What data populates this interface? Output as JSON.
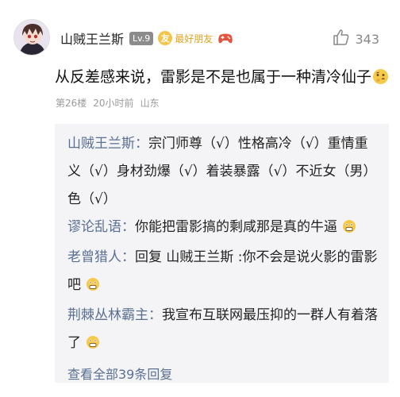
{
  "comment": {
    "author": "山贼王兰斯",
    "level": "Lv.9",
    "friend_badge_glyph": "友",
    "friend_badge": "最好朋友",
    "likes": "343",
    "text": "从反差感来说，雷影是不是也属于一种清冷仙子",
    "floor": "第26楼",
    "time": "20小时前",
    "location": "山东"
  },
  "replies": [
    {
      "author": "山贼王兰斯",
      "separator": "：",
      "text": "宗门师尊（√）性格高冷（√）重情重义（√）身材劲爆（√）着装暴露（√）不近女（男）色（√）"
    },
    {
      "author": "谬论乱语",
      "separator": "：",
      "text": "你能把雷影搞的剩咸那是真的牛逼"
    },
    {
      "author": "老曾猎人",
      "separator": "：",
      "text": "回复 山贼王兰斯 :你不会是说火影的雷影吧"
    },
    {
      "author": "荆棘丛林霸主",
      "separator": "：",
      "text": "我宣布互联网最压抑的一群人有着落了"
    }
  ],
  "view_all": "查看全部39条回复",
  "icons": {
    "avatar": "anime-avatar",
    "like": "thumbs-up-icon",
    "game": "gamepad-icon",
    "thinking": "thinking-emoji",
    "shocked": "shocked-emoji"
  },
  "colors": {
    "author_link": "#5a6f92",
    "reply_bg": "#f4f4f6",
    "meta": "#9a9a9a",
    "friend_badge": "#f3c34a"
  }
}
